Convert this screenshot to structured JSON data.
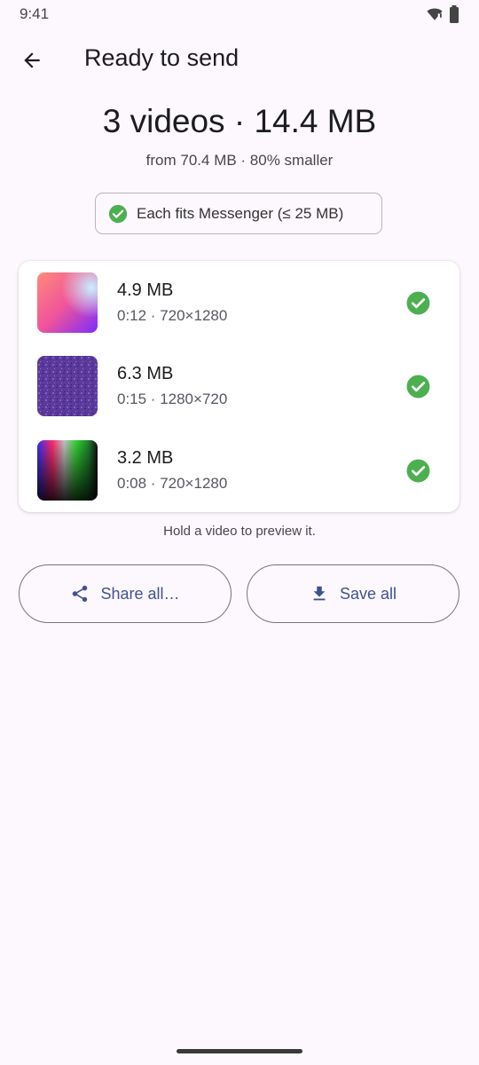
{
  "status_bar": {
    "time": "9:41",
    "icons": [
      "wifi-icon",
      "battery-icon"
    ]
  },
  "app_bar": {
    "back_icon": "arrow-back-icon",
    "title": "Ready to send"
  },
  "summary": {
    "title": "3 videos · 14.4 MB",
    "subtitle": "from 70.4 MB · 80% smaller"
  },
  "fit_chip": {
    "icon": "check-circle-icon",
    "label": "Each fits Messenger (≤ 25 MB)"
  },
  "videos": [
    {
      "size": "4.9 MB",
      "meta": "0:12 · 720×1280",
      "status_icon": "check-circle-icon"
    },
    {
      "size": "6.3 MB",
      "meta": "0:15 · 1280×720",
      "status_icon": "check-circle-icon"
    },
    {
      "size": "3.2 MB",
      "meta": "0:08 · 720×1280",
      "status_icon": "check-circle-icon"
    }
  ],
  "hint": "Hold a video to preview it.",
  "actions": {
    "share": {
      "label": "Share all…",
      "icon": "share-icon"
    },
    "save": {
      "label": "Save all",
      "icon": "download-icon"
    }
  },
  "colors": {
    "accent": "#3f5290",
    "success": "#4caf50",
    "background": "#fdf8fd"
  }
}
